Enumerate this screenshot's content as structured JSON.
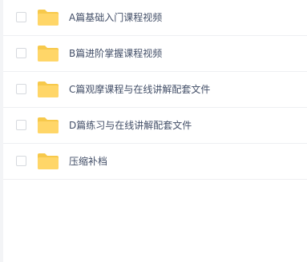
{
  "files": [
    {
      "name": "A篇基础入门课程视频",
      "type": "folder",
      "icon": "folder-icon",
      "checked": false
    },
    {
      "name": "B篇进阶掌握课程视频",
      "type": "folder",
      "icon": "folder-icon",
      "checked": false
    },
    {
      "name": "C篇观摩课程与在线讲解配套文件",
      "type": "folder",
      "icon": "folder-icon",
      "checked": false
    },
    {
      "name": "D篇练习与在线讲解配套文件",
      "type": "folder",
      "icon": "folder-icon",
      "checked": false
    },
    {
      "name": "压缩补档",
      "type": "folder",
      "icon": "folder-icon",
      "checked": false
    }
  ],
  "colors": {
    "folder": "#ffd668",
    "folder_tab": "#f7c94b",
    "text": "#424e67",
    "divider": "#eeeff2"
  }
}
